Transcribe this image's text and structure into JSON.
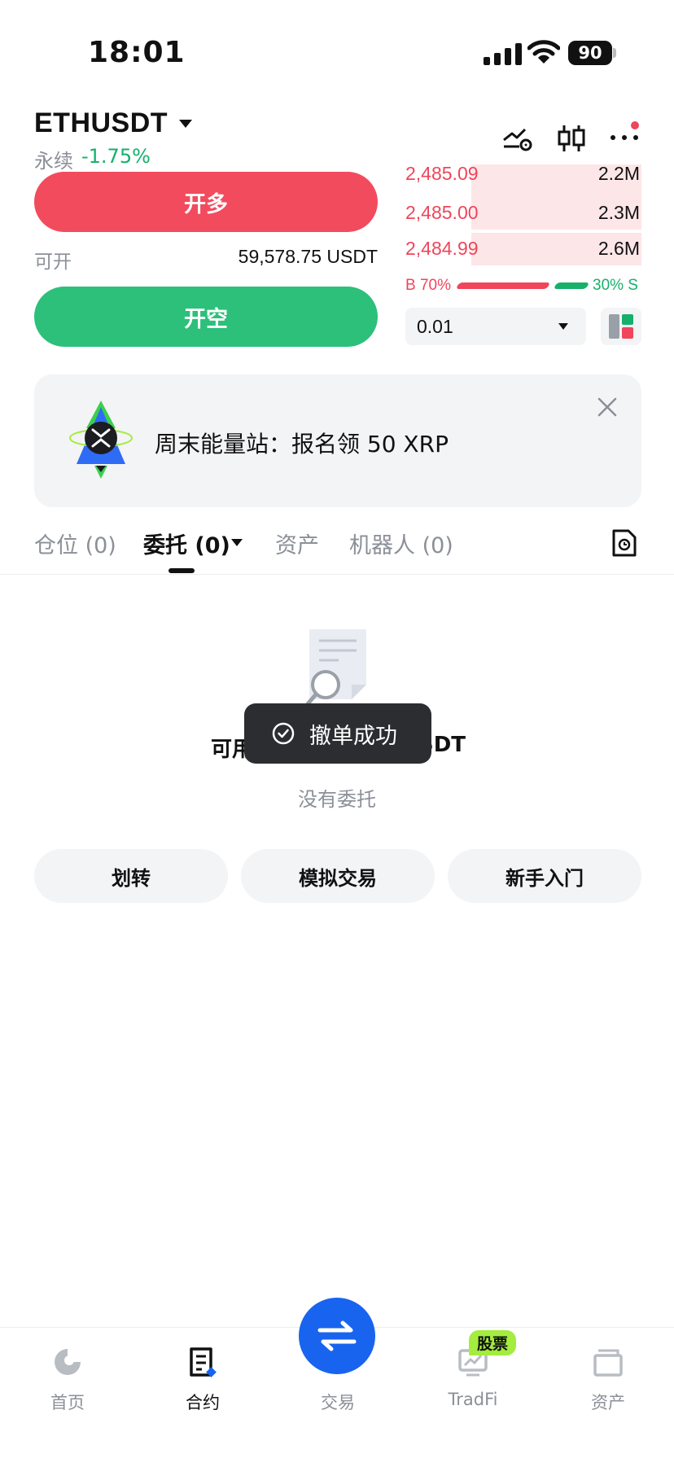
{
  "status_bar": {
    "time": "18:01",
    "battery": "90"
  },
  "header": {
    "symbol": "ETHUSDT",
    "contract_type": "永续",
    "change": "-1.75%"
  },
  "trade": {
    "long_label": "开多",
    "short_label": "开空",
    "available_label": "可开",
    "available_value": "59,578.75 USDT"
  },
  "order_book": {
    "asks": [
      {
        "price": "2,485.09",
        "qty": "2.2M",
        "depth": 0.72
      },
      {
        "price": "2,485.00",
        "qty": "2.3M",
        "depth": 0.72
      },
      {
        "price": "2,484.99",
        "qty": "2.6M",
        "depth": 0.72
      }
    ],
    "buy_ratio": "B 70%",
    "sell_ratio": "30% S",
    "quantity_step": "0.01"
  },
  "banner": {
    "text": "周末能量站：报名领 50 XRP"
  },
  "tabs": [
    {
      "label": "仓位 (0)"
    },
    {
      "label": "委托 (0)"
    },
    {
      "label": "资产"
    },
    {
      "label": "机器人 (0)"
    }
  ],
  "empty_state": {
    "available_left": "可用",
    "available_right": "SDT",
    "subtitle": "没有委托"
  },
  "actions": {
    "transfer": "划转",
    "demo": "模拟交易",
    "beginner": "新手入门"
  },
  "toast": {
    "text": "撤单成功"
  },
  "nav": {
    "home": "首页",
    "futures": "合约",
    "trade": "交易",
    "tradfi": "TradFi",
    "tradfi_badge": "股票",
    "assets": "资产"
  },
  "colors": {
    "long": "#f24b5d",
    "short": "#2cc07a",
    "accent": "#1864ef",
    "badge": "#a4ec3e"
  }
}
